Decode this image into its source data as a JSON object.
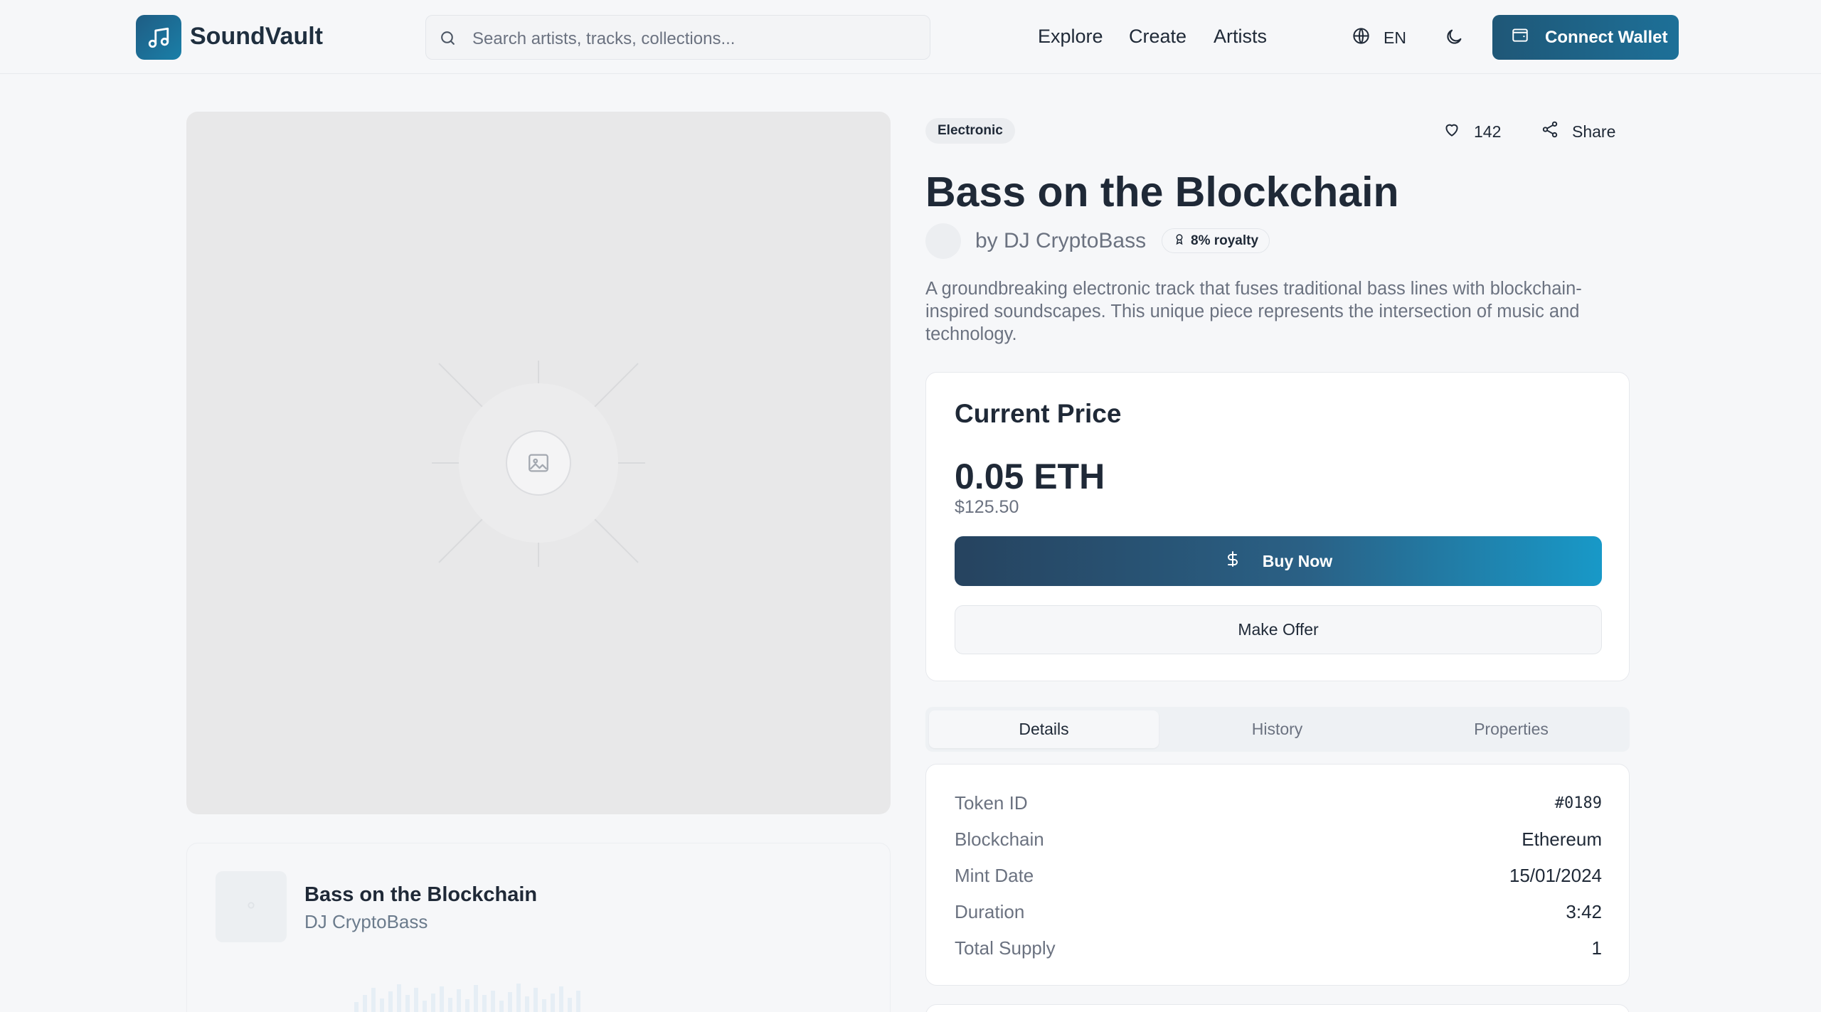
{
  "brand": {
    "name": "SoundVault",
    "accent": "#1f5d84"
  },
  "search": {
    "placeholder": "Search artists, tracks, collections..."
  },
  "nav": [
    {
      "label": "Explore"
    },
    {
      "label": "Create"
    },
    {
      "label": "Artists"
    }
  ],
  "language": {
    "label": "EN",
    "icon": "globe-icon"
  },
  "theme_toggle": {
    "icon": "moon-icon"
  },
  "wallet_button": {
    "label": "Connect Wallet",
    "icon": "wallet-icon"
  },
  "artwork": {
    "icon": "image-placeholder-icon"
  },
  "preview": {
    "title": "Bass on the Blockchain",
    "artist": "DJ CryptoBass"
  },
  "track": {
    "genre": "Electronic",
    "likes": "142",
    "share_label": "Share",
    "title": "Bass on the Blockchain",
    "artist": "by DJ CryptoBass",
    "royalty": "8% royalty",
    "description": "A groundbreaking electronic track that fuses traditional bass lines with blockchain-inspired soundscapes. This unique piece represents the intersection of music and technology."
  },
  "price": {
    "label": "Current Price",
    "eth": "0.05 ETH",
    "usd": "$125.50",
    "buy_label": "Buy Now",
    "offer_label": "Make Offer"
  },
  "tabs": [
    {
      "label": "Details",
      "active": true
    },
    {
      "label": "History",
      "active": false
    },
    {
      "label": "Properties",
      "active": false
    }
  ],
  "details": [
    {
      "key": "Token ID",
      "value": "#0189"
    },
    {
      "key": "Blockchain",
      "value": "Ethereum"
    },
    {
      "key": "Mint Date",
      "value": "15/01/2024"
    },
    {
      "key": "Duration",
      "value": "3:42"
    },
    {
      "key": "Total Supply",
      "value": "1"
    }
  ]
}
